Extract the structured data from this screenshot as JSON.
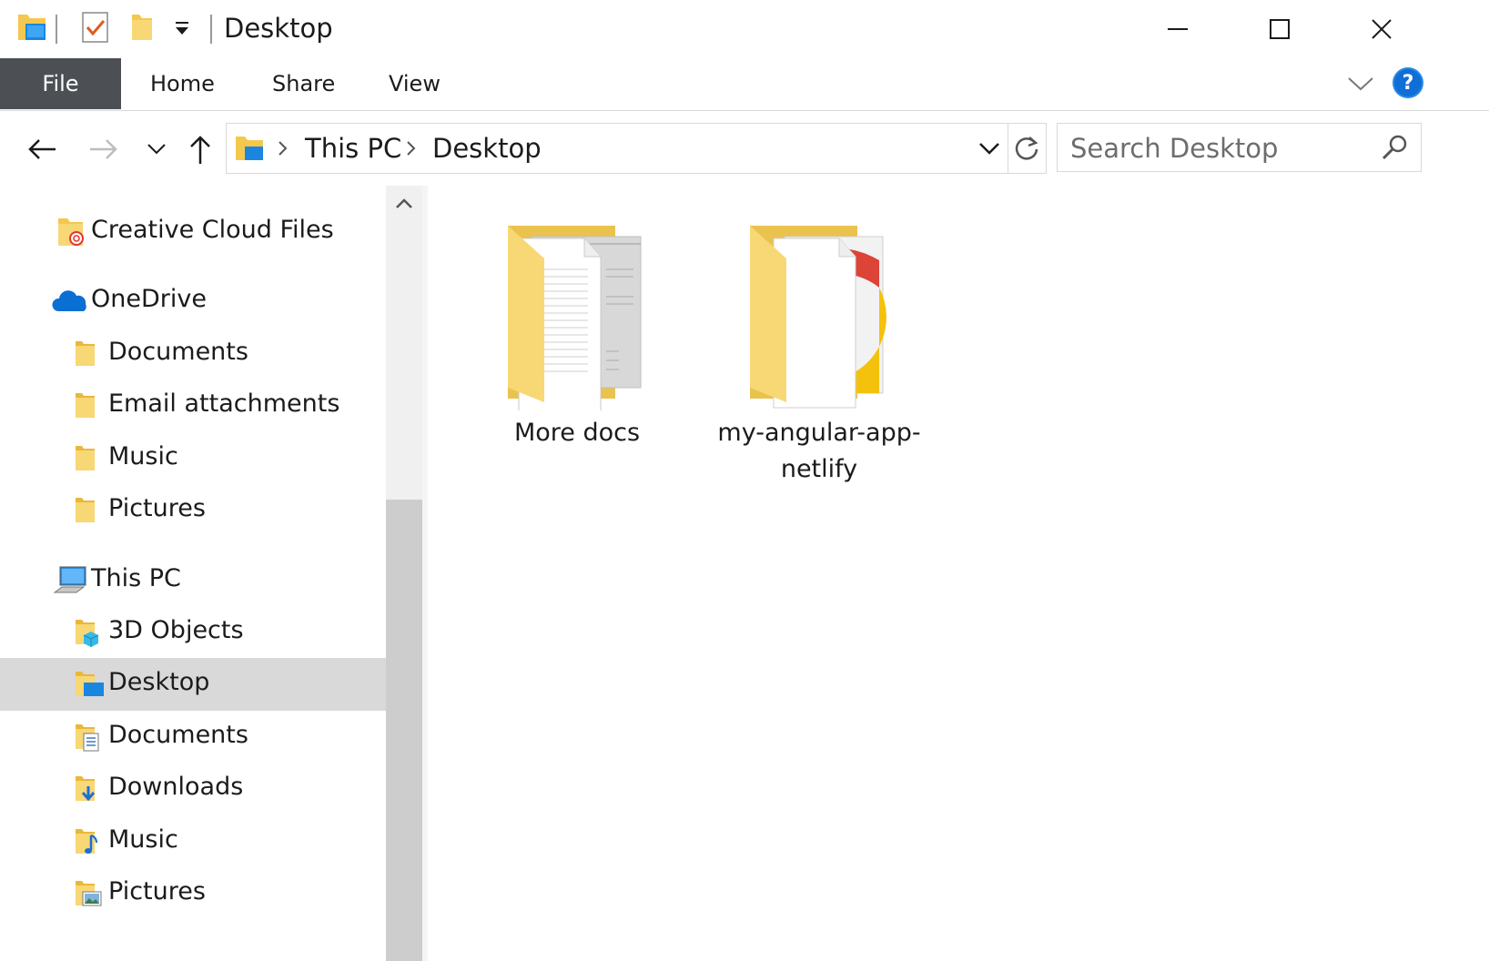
{
  "window": {
    "title": "Desktop",
    "controls": {
      "minimize": "minimize",
      "maximize": "maximize",
      "close": "close"
    }
  },
  "ribbon": {
    "tabs": [
      {
        "label": "File",
        "active": true
      },
      {
        "label": "Home"
      },
      {
        "label": "Share"
      },
      {
        "label": "View"
      }
    ],
    "help": "?"
  },
  "address": {
    "crumbs": [
      "This PC",
      "Desktop"
    ],
    "search_placeholder": "Search Desktop"
  },
  "sidebar": {
    "items": [
      {
        "label": "Creative Cloud Files",
        "icon": "creative-cloud-folder-icon",
        "level": 0
      },
      {
        "label": "OneDrive",
        "icon": "onedrive-cloud-icon",
        "level": 0
      },
      {
        "label": "Documents",
        "icon": "folder-icon",
        "level": 1
      },
      {
        "label": "Email attachments",
        "icon": "folder-icon",
        "level": 1
      },
      {
        "label": "Music",
        "icon": "folder-icon",
        "level": 1
      },
      {
        "label": "Pictures",
        "icon": "folder-icon",
        "level": 1
      },
      {
        "label": "This PC",
        "icon": "computer-icon",
        "level": 0
      },
      {
        "label": "3D Objects",
        "icon": "3d-objects-folder-icon",
        "level": 1
      },
      {
        "label": "Desktop",
        "icon": "desktop-folder-icon",
        "level": 1,
        "selected": true
      },
      {
        "label": "Documents",
        "icon": "documents-folder-icon",
        "level": 1
      },
      {
        "label": "Downloads",
        "icon": "downloads-folder-icon",
        "level": 1
      },
      {
        "label": "Music",
        "icon": "music-folder-icon",
        "level": 1
      },
      {
        "label": "Pictures",
        "icon": "pictures-folder-icon",
        "level": 1
      }
    ]
  },
  "content": {
    "items": [
      {
        "label": "More docs",
        "icon": "documents-folder-large-icon"
      },
      {
        "label": "my-angular-app-netlify",
        "line1": "my-angular-app-",
        "line2": "netlify",
        "icon": "chrome-folder-large-icon"
      }
    ]
  },
  "colors": {
    "file_tab_bg": "#4c5054",
    "selected_bg": "#d9d9d9",
    "folder_yellow": "#f8d775",
    "accent_blue": "#0f6fd6"
  }
}
